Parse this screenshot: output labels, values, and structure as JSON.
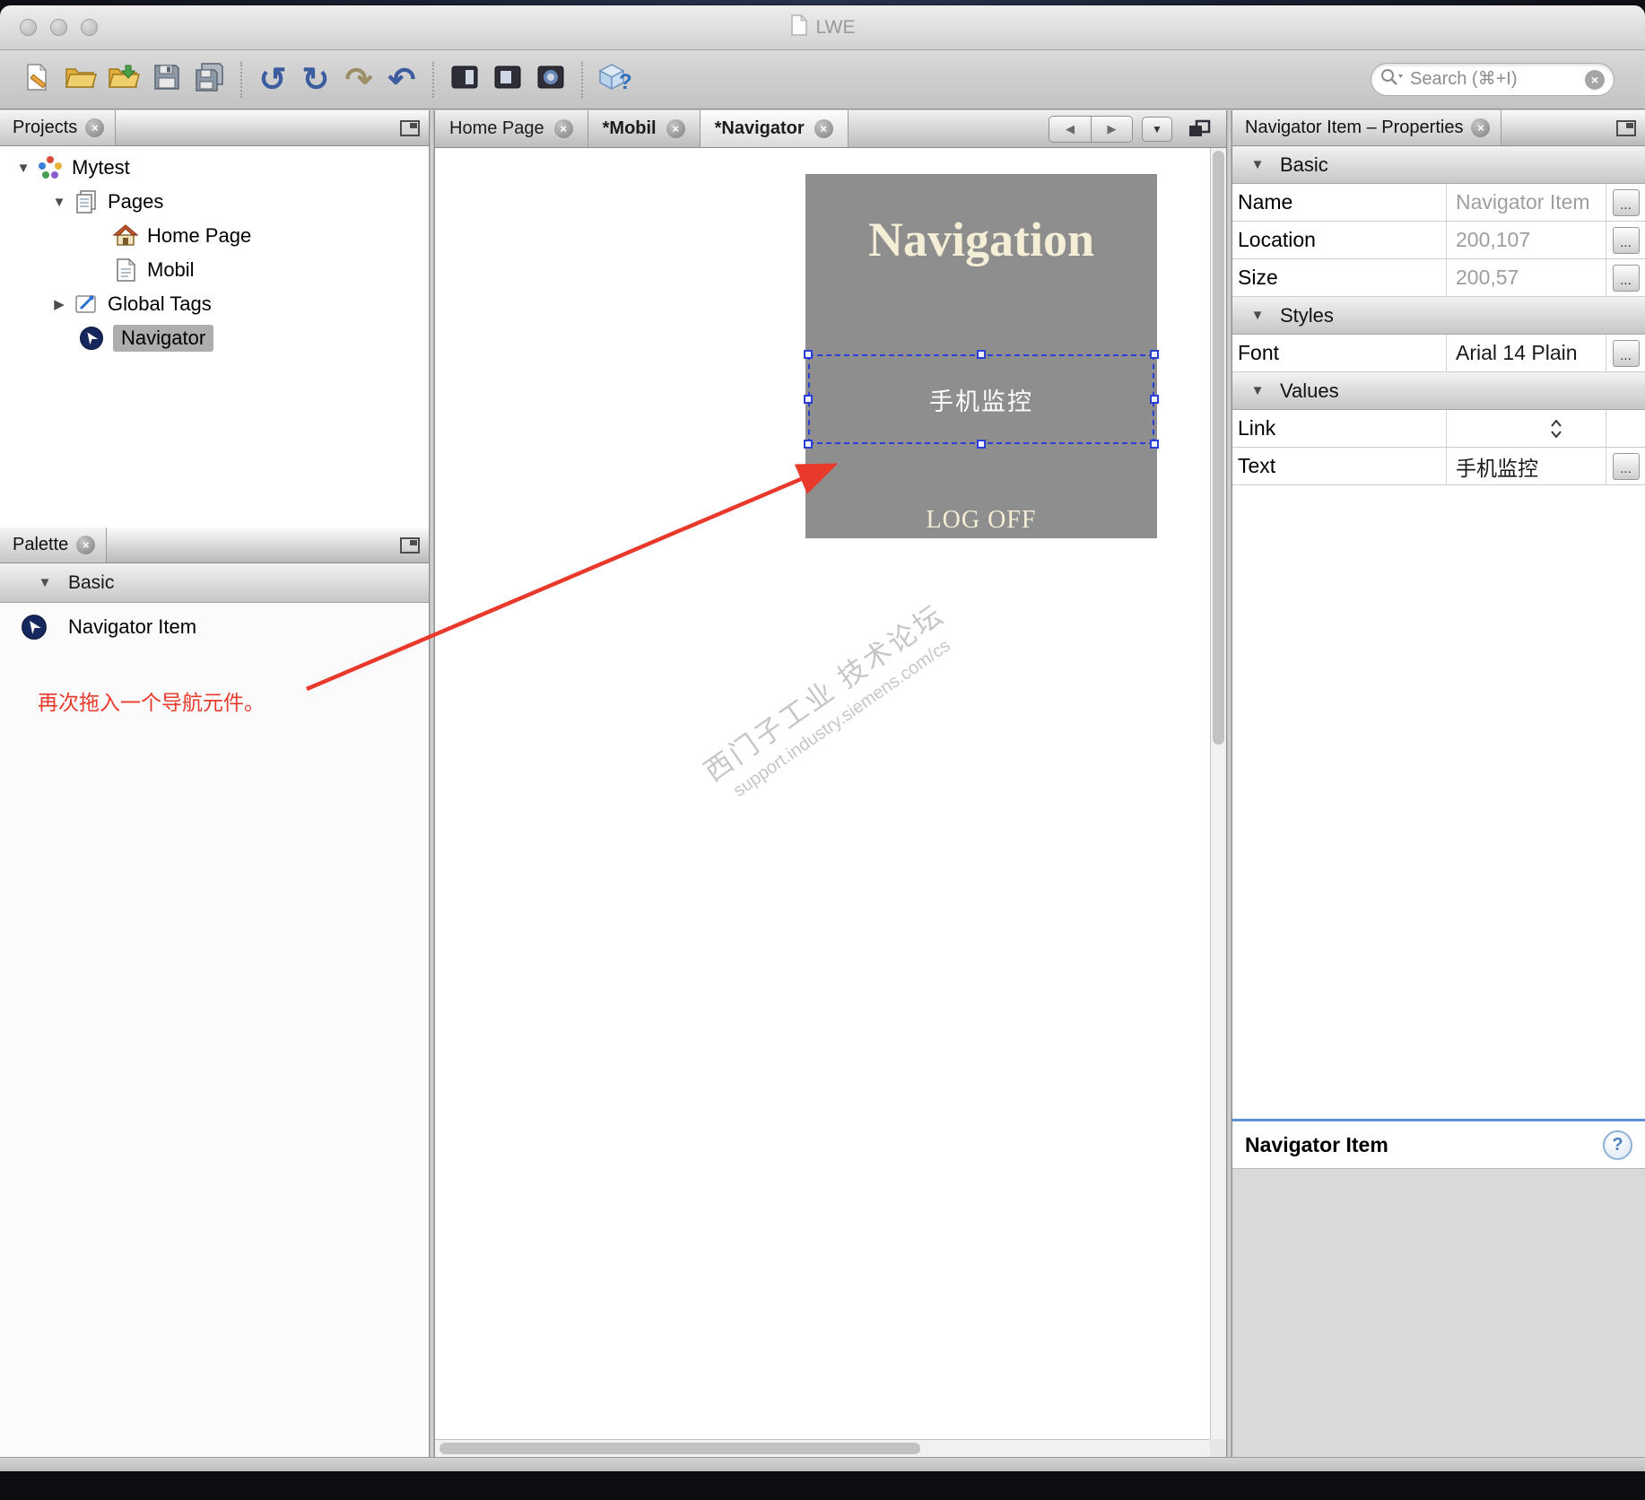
{
  "window": {
    "title": "LWE"
  },
  "toolbar": {
    "search_placeholder": "Search (⌘+I)"
  },
  "projects": {
    "title": "Projects",
    "tree": {
      "root": "Mytest",
      "pages": "Pages",
      "home": "Home Page",
      "mobil": "Mobil",
      "global_tags": "Global Tags",
      "navigator": "Navigator"
    }
  },
  "palette": {
    "title": "Palette",
    "section": "Basic",
    "item": "Navigator Item",
    "annotation": "再次拖入一个导航元件。"
  },
  "editor": {
    "tabs": {
      "home": "Home Page",
      "mobil": "*Mobil",
      "navigator": "*Navigator"
    },
    "canvas": {
      "heading": "Navigation",
      "selected_item_text": "手机监控",
      "logoff_text": "LOG OFF",
      "watermark_line1": "西门子工业 技术论坛",
      "watermark_line2": "support.industry.siemens.com/cs"
    }
  },
  "properties": {
    "title": "Navigator Item – Properties",
    "section_basic": "Basic",
    "section_styles": "Styles",
    "section_values": "Values",
    "name_label": "Name",
    "name_value": "Navigator Item",
    "location_label": "Location",
    "location_value": "200,107",
    "size_label": "Size",
    "size_value": "200,57",
    "font_label": "Font",
    "font_value": "Arial 14 Plain",
    "link_label": "Link",
    "text_label": "Text",
    "text_value": "手机监控",
    "more": "...",
    "help_title": "Navigator Item",
    "help_badge": "?"
  },
  "colors": {
    "annotation_red": "#e8392b",
    "selection_blue": "#2b3fd6",
    "canvas_box_gray": "#8e8e8e",
    "cream_text": "#f4eed6"
  }
}
